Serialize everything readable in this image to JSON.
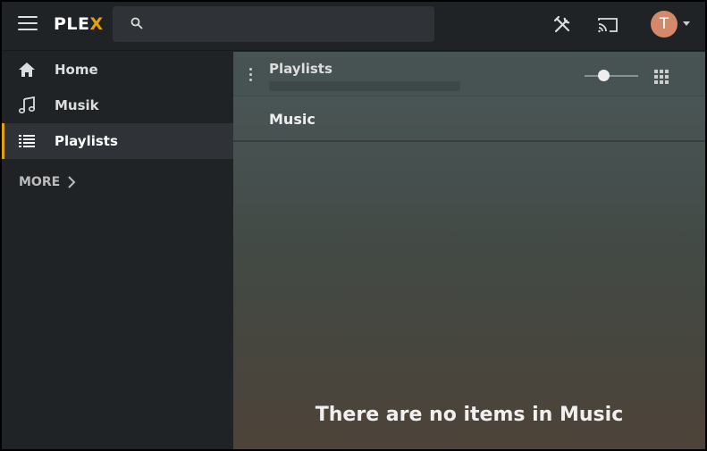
{
  "header": {
    "logo_prefix": "PLE",
    "logo_accent": "X",
    "search_placeholder": "",
    "avatar_initial": "T",
    "accent_color": "#e5a00d"
  },
  "sidebar": {
    "items": [
      {
        "label": "Home",
        "icon": "home-icon"
      },
      {
        "label": "Musik",
        "icon": "music-note-icon"
      },
      {
        "label": "Playlists",
        "icon": "list-icon",
        "active": true
      }
    ],
    "more_label": "MORE"
  },
  "main": {
    "breadcrumb": "Playlists",
    "section_title": "Music",
    "empty_message": "There are no items in Music"
  }
}
